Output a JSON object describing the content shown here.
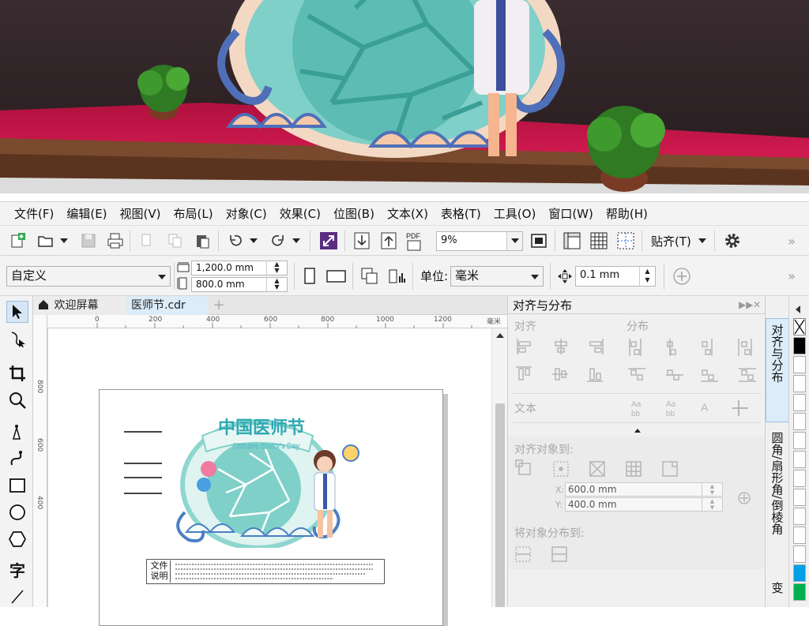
{
  "menu": [
    "文件(F)",
    "编辑(E)",
    "视图(V)",
    "布局(L)",
    "对象(C)",
    "效果(C)",
    "位图(B)",
    "文本(X)",
    "表格(T)",
    "工具(O)",
    "窗口(W)",
    "帮助(H)"
  ],
  "toolbar": {
    "zoom_value": "9%",
    "snap_label": "贴齐(T)",
    "more_glyph": "»"
  },
  "property_bar": {
    "page_preset": "自定义",
    "width_value": "1,200.0 mm",
    "height_value": "800.0 mm",
    "units_label": "单位:",
    "units_value": "毫米",
    "nudge_value": "0.1 mm"
  },
  "doc_tabs": [
    "欢迎屏幕",
    "医师节.cdr"
  ],
  "ruler": {
    "h_ticks": [
      "0",
      "200",
      "400",
      "600",
      "800",
      "1000",
      "1200"
    ],
    "h_unit": "毫米",
    "v_ticks": [
      "800",
      "600",
      "400"
    ]
  },
  "artwork": {
    "title_cn": "中国医师节",
    "title_en": "Chinese doctor's Day",
    "note_label": "文件说明"
  },
  "dock": {
    "title": "对齐与分布",
    "align_label": "对齐",
    "distribute_label": "分布",
    "text_label": "文本",
    "align_to_label": "对齐对象到:",
    "x_value": "600.0 mm",
    "y_value": "400.0 mm",
    "x_label": "X:",
    "y_label": "Y:",
    "distribute_to_label": "将对象分布到:"
  },
  "vertical_tabs": [
    "对齐与分布",
    "圆角/扇形角/倒棱角",
    "变"
  ],
  "palette_colors": [
    "#ffffff",
    "#000000",
    "#ffffff",
    "#ffffff",
    "#ffffff",
    "#ffffff",
    "#00a0e9",
    "#00b050"
  ]
}
